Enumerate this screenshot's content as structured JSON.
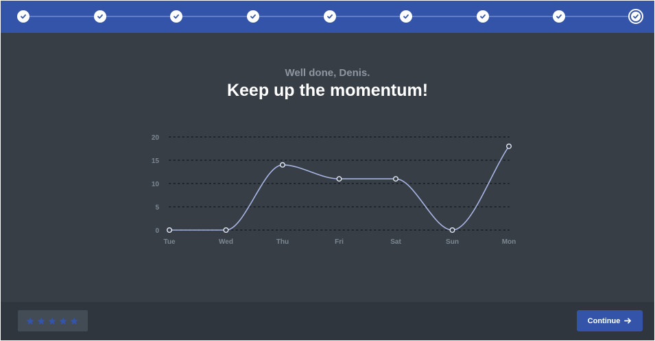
{
  "progress": {
    "steps": [
      {
        "state": "done",
        "icon": "check-icon"
      },
      {
        "state": "done",
        "icon": "check-icon"
      },
      {
        "state": "done",
        "icon": "check-icon"
      },
      {
        "state": "done",
        "icon": "check-icon"
      },
      {
        "state": "done",
        "icon": "check-icon"
      },
      {
        "state": "done",
        "icon": "check-icon"
      },
      {
        "state": "done",
        "icon": "check-icon"
      },
      {
        "state": "done",
        "icon": "check-icon"
      },
      {
        "state": "current",
        "icon": "check-icon"
      }
    ]
  },
  "main": {
    "greeting": "Well done, Denis.",
    "headline": "Keep up the momentum!"
  },
  "chart_data": {
    "type": "line",
    "categories": [
      "Tue",
      "Wed",
      "Thu",
      "Fri",
      "Sat",
      "Sun",
      "Mon"
    ],
    "values": [
      0,
      0,
      14,
      11,
      11,
      0,
      18
    ],
    "yticks": [
      0,
      5,
      10,
      15,
      20
    ],
    "ylim": [
      0,
      20
    ],
    "grid": true,
    "line_color": "#a9b6e6"
  },
  "footer": {
    "rating_stars": 5,
    "star_icon": "star-icon",
    "continue_label": "Continue",
    "continue_icon": "arrow-right-icon"
  },
  "colors": {
    "accent": "#3354a8",
    "background": "#373e45",
    "footer": "#30363d"
  }
}
